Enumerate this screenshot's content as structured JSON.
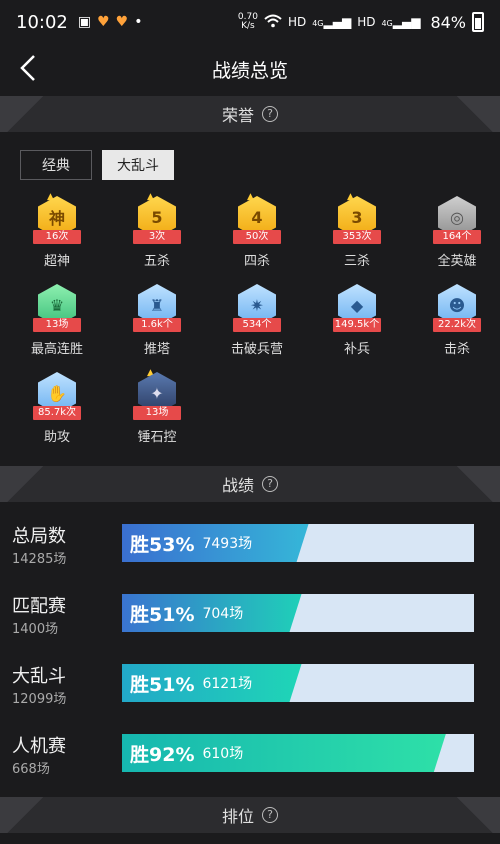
{
  "status": {
    "time": "10:02",
    "net_speed_value": "0.70",
    "net_speed_unit": "K/s",
    "hd1": "HD",
    "sig1": "4G",
    "hd2": "HD",
    "sig2": "4G",
    "battery": "84%"
  },
  "nav": {
    "title": "战绩总览"
  },
  "sections": {
    "honor": "荣誉",
    "record": "战绩",
    "rank": "排位",
    "help": "?"
  },
  "tabs": [
    {
      "label": "经典",
      "active": false
    },
    {
      "label": "大乱斗",
      "active": true
    }
  ],
  "honors": [
    {
      "label": "超神",
      "value": "16次",
      "glyph": "神",
      "color": "gold",
      "icon": "super-god-badge-icon"
    },
    {
      "label": "五杀",
      "value": "3次",
      "glyph": "5",
      "color": "gold",
      "icon": "penta-kill-badge-icon"
    },
    {
      "label": "四杀",
      "value": "50次",
      "glyph": "4",
      "color": "gold",
      "icon": "quadra-kill-badge-icon"
    },
    {
      "label": "三杀",
      "value": "353次",
      "glyph": "3",
      "color": "gold",
      "icon": "triple-kill-badge-icon"
    },
    {
      "label": "全英雄",
      "value": "164个",
      "glyph": "◎",
      "color": "gray",
      "icon": "all-heroes-badge-icon"
    },
    {
      "label": "最高连胜",
      "value": "13场",
      "glyph": "♛",
      "color": "green",
      "icon": "win-streak-badge-icon"
    },
    {
      "label": "推塔",
      "value": "1.6k个",
      "glyph": "♜",
      "color": "blue",
      "icon": "tower-push-badge-icon"
    },
    {
      "label": "击破兵营",
      "value": "534个",
      "glyph": "✷",
      "color": "blue",
      "icon": "barracks-badge-icon"
    },
    {
      "label": "补兵",
      "value": "149.5k个",
      "glyph": "◆",
      "color": "blue",
      "icon": "last-hit-badge-icon"
    },
    {
      "label": "击杀",
      "value": "22.2k次",
      "glyph": "☻",
      "color": "blue",
      "icon": "kill-badge-icon"
    },
    {
      "label": "助攻",
      "value": "85.7k次",
      "glyph": "✋",
      "color": "blue",
      "icon": "assist-badge-icon"
    },
    {
      "label": "锤石控",
      "value": "13场",
      "glyph": "✦",
      "color": "dark",
      "icon": "thresh-badge-icon"
    }
  ],
  "records": [
    {
      "name": "总局数",
      "count": "14285场",
      "pct_text": "胜53%",
      "wins": "7493场",
      "rate": 0.53,
      "from": "#3a6fd0",
      "to": "#35b7d8"
    },
    {
      "name": "匹配赛",
      "count": "1400场",
      "pct_text": "胜51%",
      "wins": "704场",
      "rate": 0.51,
      "from": "#3a74d0",
      "to": "#1fd0b8"
    },
    {
      "name": "大乱斗",
      "count": "12099场",
      "pct_text": "胜51%",
      "wins": "6121场",
      "rate": 0.51,
      "from": "#22a8c8",
      "to": "#1fd6b6"
    },
    {
      "name": "人机赛",
      "count": "668场",
      "pct_text": "胜92%",
      "wins": "610场",
      "rate": 0.92,
      "from": "#16b7b0",
      "to": "#2ee0a8"
    }
  ]
}
